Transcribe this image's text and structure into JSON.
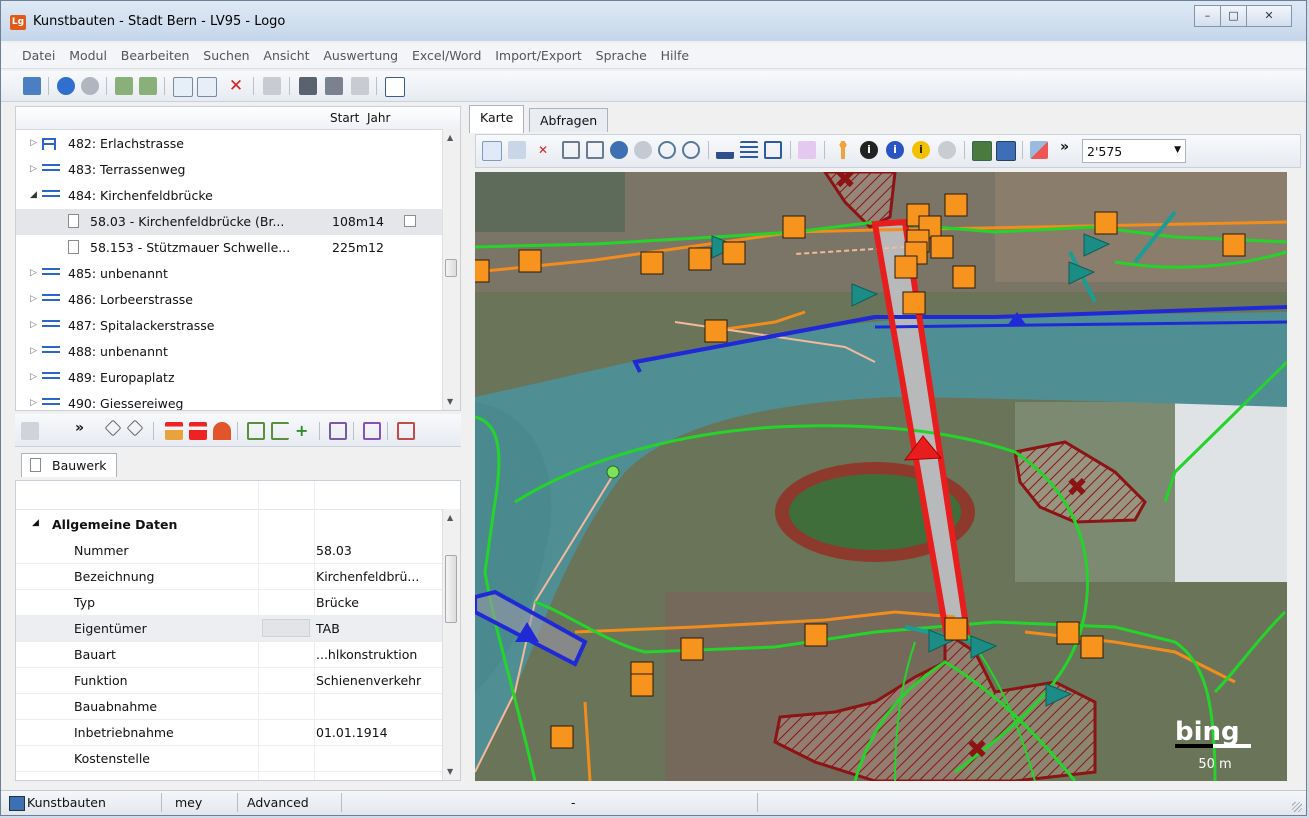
{
  "window": {
    "title": "Kunstbauten - Stadt Bern - LV95 - Logo",
    "icon": "Lg"
  },
  "menu": [
    "Datei",
    "Modul",
    "Bearbeiten",
    "Suchen",
    "Ansicht",
    "Auswertung",
    "Excel/Word",
    "Import/Export",
    "Sprache",
    "Hilfe"
  ],
  "tree": {
    "columns": {
      "start": "Start",
      "jahr": "Jahr"
    },
    "rows": [
      {
        "label": "482: Erlachstrasse",
        "level": 0,
        "expanded": false
      },
      {
        "label": "483: Terrassenweg",
        "level": 0,
        "expanded": false
      },
      {
        "label": "484: Kirchenfeldbrücke",
        "level": 0,
        "expanded": true
      },
      {
        "label": "58.03 - Kirchenfeldbrücke (Br...",
        "level": 1,
        "length": "108m",
        "year": "14",
        "selected": true
      },
      {
        "label": "58.153 - Stützmauer Schwelle...",
        "level": 1,
        "length": "225m",
        "year": "12"
      },
      {
        "label": "485: unbenannt",
        "level": 0,
        "expanded": false
      },
      {
        "label": "486: Lorbeerstrasse",
        "level": 0,
        "expanded": false
      },
      {
        "label": "487: Spitalackerstrasse",
        "level": 0,
        "expanded": false
      },
      {
        "label": "488: unbenannt",
        "level": 0,
        "expanded": false
      },
      {
        "label": "489: Europaplatz",
        "level": 0,
        "expanded": false
      },
      {
        "label": "490: Giessereiweg",
        "level": 0,
        "expanded": false
      }
    ]
  },
  "panel_tab": "Bauwerk",
  "props": {
    "section": "Allgemeine Daten",
    "rows": [
      {
        "label": "Nummer",
        "value": "58.03"
      },
      {
        "label": "Bezeichnung",
        "value": "Kirchenfeldbrü..."
      },
      {
        "label": "Typ",
        "value": "Brücke"
      },
      {
        "label": "Eigentümer",
        "value": "TAB"
      },
      {
        "label": "Bauart",
        "value": "...hlkonstruktion"
      },
      {
        "label": "Funktion",
        "value": "Schienenverkehr"
      },
      {
        "label": "Bauabnahme",
        "value": ""
      },
      {
        "label": "Inbetriebnahme",
        "value": "01.01.1914"
      },
      {
        "label": "Kostenstelle",
        "value": ""
      }
    ]
  },
  "map": {
    "tabs": [
      "Karte",
      "Abfragen"
    ],
    "scale": "2'575",
    "scalebar": "50 m",
    "provider": "bing"
  },
  "status": {
    "module": "Kunstbauten",
    "user": "mey",
    "mode": "Advanced",
    "info": "-"
  },
  "colors": {
    "bridge": "#e81d1d",
    "road": "#24d42a",
    "path": "#f28c1c",
    "water": "#1f2ad6",
    "marker": "#f7941d",
    "zone": "#8c1414"
  }
}
